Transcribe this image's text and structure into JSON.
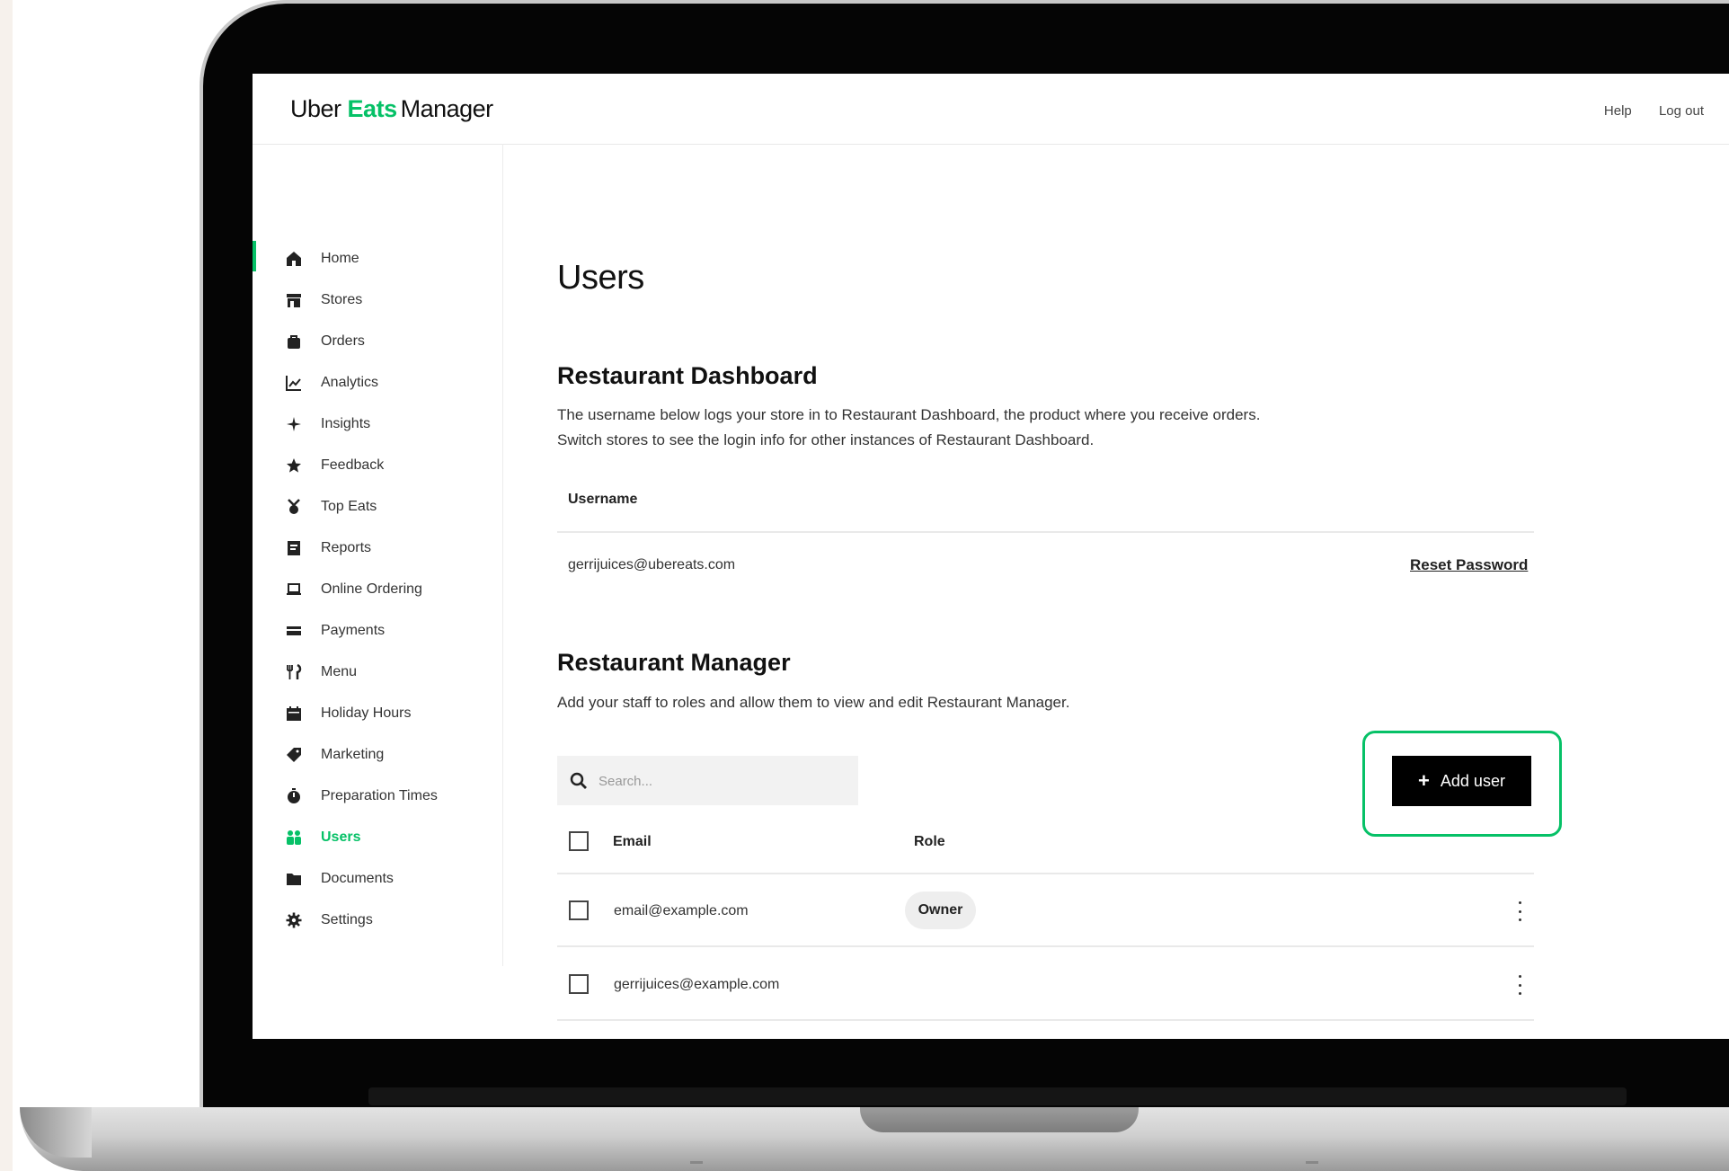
{
  "app": {
    "logo_part1": "Uber",
    "logo_part2": "Eats",
    "logo_part3": "Manager",
    "brand_color": "#06c167"
  },
  "topbar": {
    "help_label": "Help",
    "logout_label": "Log out"
  },
  "sidebar": {
    "items": [
      {
        "label": "Home",
        "icon": "home-icon"
      },
      {
        "label": "Stores",
        "icon": "store-icon"
      },
      {
        "label": "Orders",
        "icon": "bag-icon"
      },
      {
        "label": "Analytics",
        "icon": "chart-icon"
      },
      {
        "label": "Insights",
        "icon": "sparkle-icon"
      },
      {
        "label": "Feedback",
        "icon": "star-icon"
      },
      {
        "label": "Top Eats",
        "icon": "medal-icon"
      },
      {
        "label": "Reports",
        "icon": "report-icon"
      },
      {
        "label": "Online Ordering",
        "icon": "laptop-icon"
      },
      {
        "label": "Payments",
        "icon": "card-icon"
      },
      {
        "label": "Menu",
        "icon": "utensils-icon"
      },
      {
        "label": "Holiday Hours",
        "icon": "calendar-icon"
      },
      {
        "label": "Marketing",
        "icon": "tag-icon"
      },
      {
        "label": "Preparation Times",
        "icon": "timer-icon"
      },
      {
        "label": "Users",
        "icon": "users-icon",
        "active": true
      },
      {
        "label": "Documents",
        "icon": "folder-icon"
      },
      {
        "label": "Settings",
        "icon": "gear-icon"
      }
    ]
  },
  "main": {
    "page_title": "Users",
    "dashboard": {
      "title": "Restaurant Dashboard",
      "description": "The username below logs your store in to Restaurant Dashboard, the product where you receive orders. Switch stores to see the login info for other instances of Restaurant Dashboard.",
      "username_header": "Username",
      "username_value": "gerrijuices@ubereats.com",
      "reset_label": "Reset Password"
    },
    "manager": {
      "title": "Restaurant Manager",
      "description": "Add your staff to roles and allow them to view and edit Restaurant Manager.",
      "search_placeholder": "Search...",
      "add_user_label": "Add user",
      "columns": {
        "email": "Email",
        "role": "Role"
      },
      "rows": [
        {
          "email": "email@example.com",
          "role": "Owner"
        },
        {
          "email": "gerrijuices@example.com",
          "role": ""
        }
      ]
    }
  }
}
